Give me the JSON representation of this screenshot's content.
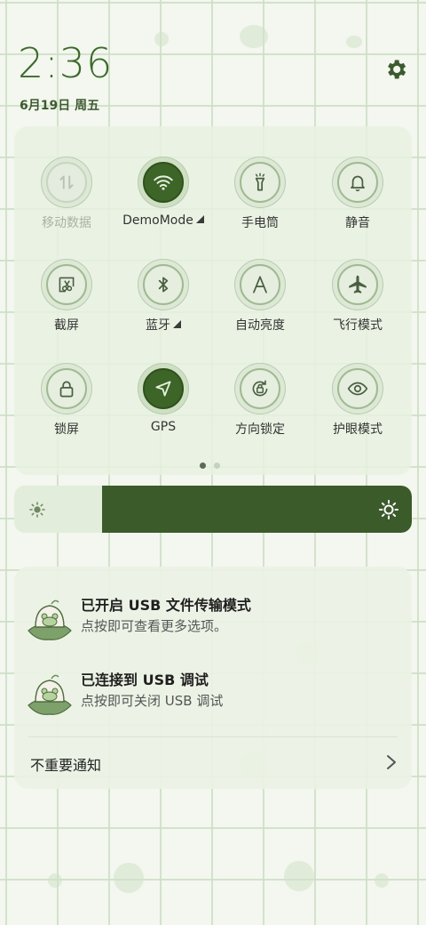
{
  "status": {
    "time": "2:36",
    "date": "6月19日 周五"
  },
  "tiles": [
    {
      "label": "移动数据",
      "icon": "mobile-data-icon",
      "state": "disabled"
    },
    {
      "label": "DemoMode",
      "icon": "wifi-icon",
      "state": "on",
      "expand": true
    },
    {
      "label": "手电筒",
      "icon": "flashlight-icon",
      "state": "off"
    },
    {
      "label": "静音",
      "icon": "bell-icon",
      "state": "off"
    },
    {
      "label": "截屏",
      "icon": "screenshot-icon",
      "state": "off"
    },
    {
      "label": "蓝牙",
      "icon": "bluetooth-icon",
      "state": "off",
      "expand": true
    },
    {
      "label": "自动亮度",
      "icon": "auto-brightness-icon",
      "state": "off"
    },
    {
      "label": "飞行模式",
      "icon": "airplane-icon",
      "state": "off"
    },
    {
      "label": "锁屏",
      "icon": "lock-icon",
      "state": "off"
    },
    {
      "label": "GPS",
      "icon": "location-arrow-icon",
      "state": "on"
    },
    {
      "label": "方向锁定",
      "icon": "rotation-lock-icon",
      "state": "off"
    },
    {
      "label": "护眼模式",
      "icon": "eye-icon",
      "state": "off"
    }
  ],
  "pager": {
    "current": 1,
    "total": 2
  },
  "brightness": {
    "level": 0.78
  },
  "notifications": [
    {
      "title": "已开启 USB 文件传输模式",
      "subtitle": "点按即可查看更多选项。",
      "icon": "app-frog-icon"
    },
    {
      "title": "已连接到 USB 调试",
      "subtitle": "点按即可关闭 USB 调试",
      "icon": "app-frog-icon"
    }
  ],
  "unimportant": {
    "label": "不重要通知"
  },
  "colors": {
    "accent": "#3c6527",
    "slider": "#3b5b2a",
    "background": "#f3f7ef"
  }
}
